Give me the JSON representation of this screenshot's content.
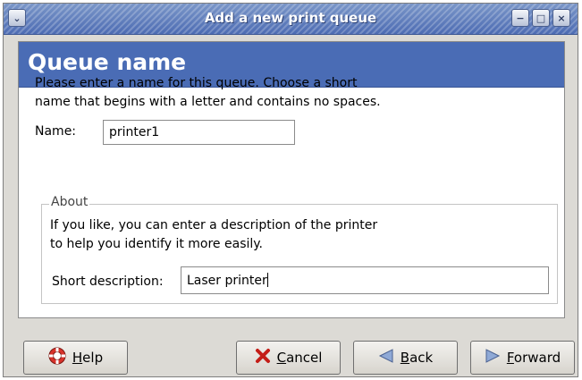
{
  "window": {
    "title": "Add a new print queue",
    "controls": {
      "menu": "⌄",
      "minimize": "−",
      "maximize": "□",
      "close": "×"
    }
  },
  "header": {
    "title": "Queue name"
  },
  "instructions": "Please enter a name for this queue.  Choose a short\nname that begins with a letter and contains no spaces.",
  "name_field": {
    "label": "Name:",
    "value": "printer1"
  },
  "about": {
    "legend": "About",
    "text": "If you like, you can enter a description of the printer\nto help you identify it more easily.",
    "description_label": "Short description:",
    "description_value": "Laser printer"
  },
  "buttons": {
    "help": {
      "mnemonic": "H",
      "rest": "elp"
    },
    "cancel": {
      "mnemonic": "C",
      "rest": "ancel"
    },
    "back": {
      "mnemonic": "B",
      "rest": "ack"
    },
    "forward": {
      "mnemonic": "F",
      "rest": "orward"
    }
  },
  "colors": {
    "header_band": "#4a6cb5",
    "titlebar": "#4d6cb3",
    "window_bg": "#dcdad5"
  }
}
